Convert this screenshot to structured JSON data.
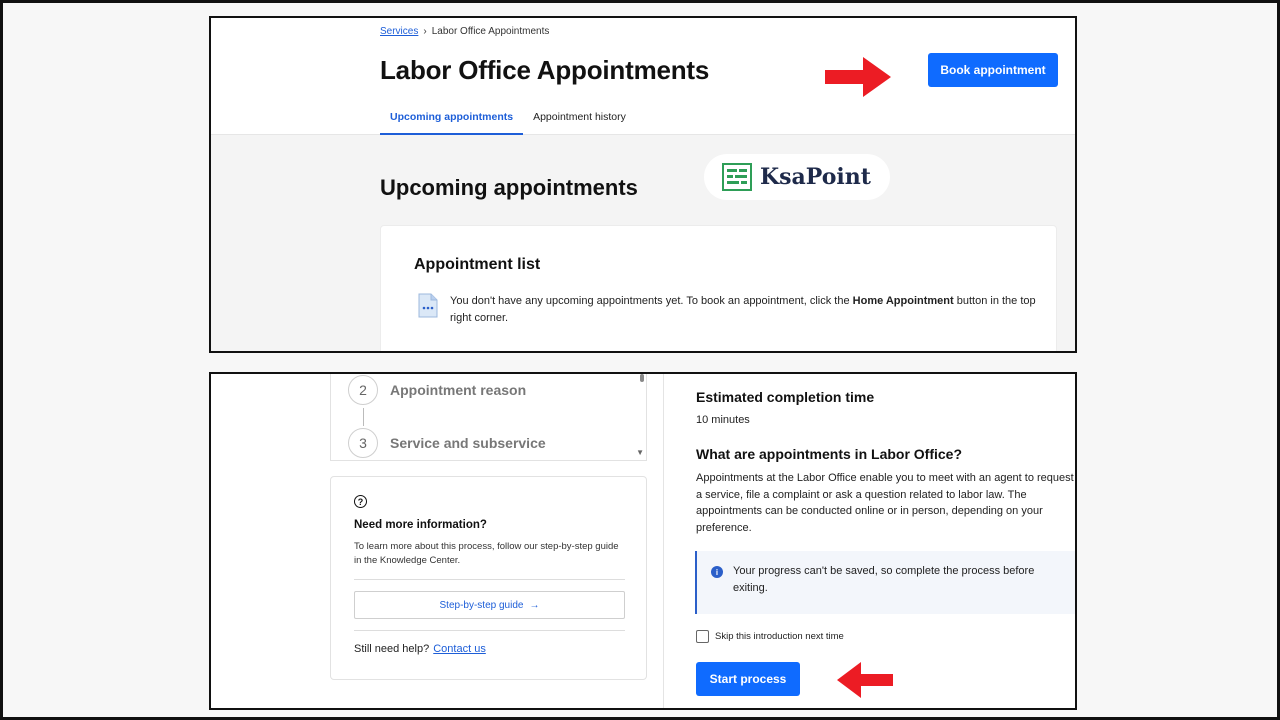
{
  "top": {
    "breadcrumb": {
      "link": "Services",
      "separator": "›",
      "current": "Labor Office Appointments"
    },
    "title": "Labor Office Appointments",
    "book_button": "Book appointment",
    "tabs": [
      {
        "label": "Upcoming appointments",
        "active": true
      },
      {
        "label": "Appointment history",
        "active": false
      }
    ],
    "section_title": "Upcoming appointments",
    "watermark": "KsaPoint",
    "card": {
      "title": "Appointment list",
      "notice_before": "You don't have any upcoming appointments yet. To book an appointment, click the ",
      "notice_bold": "Home Appointment",
      "notice_after": " button in the top right corner."
    }
  },
  "bottom": {
    "steps": [
      {
        "num": "2",
        "label": "Appointment reason"
      },
      {
        "num": "3",
        "label": "Service and subservice"
      }
    ],
    "info": {
      "icon": "?",
      "title": "Need more information?",
      "text": "To learn more about this process, follow our step-by-step guide in the Knowledge Center.",
      "guide_button": "Step-by-step guide",
      "guide_arrow": "→",
      "still_help": "Still need help?",
      "contact_link": "Contact us"
    },
    "estimate": {
      "title": "Estimated completion time",
      "value": "10 minutes"
    },
    "what": {
      "title": "What are appointments in Labor Office?",
      "text": "Appointments at the Labor Office enable you to meet with an agent to request a service, file a complaint or ask a question related to labor law. The appointments can be conducted online or in person, depending on your preference."
    },
    "alert": {
      "icon": "i",
      "text": "Your progress can't be saved, so complete the process before exiting."
    },
    "skip_label": "Skip this introduction next time",
    "start_button": "Start process"
  },
  "colors": {
    "primary": "#0f6bff",
    "link": "#1d5ed8",
    "arrow": "#ec1c24",
    "logo_green": "#2e9e57"
  }
}
